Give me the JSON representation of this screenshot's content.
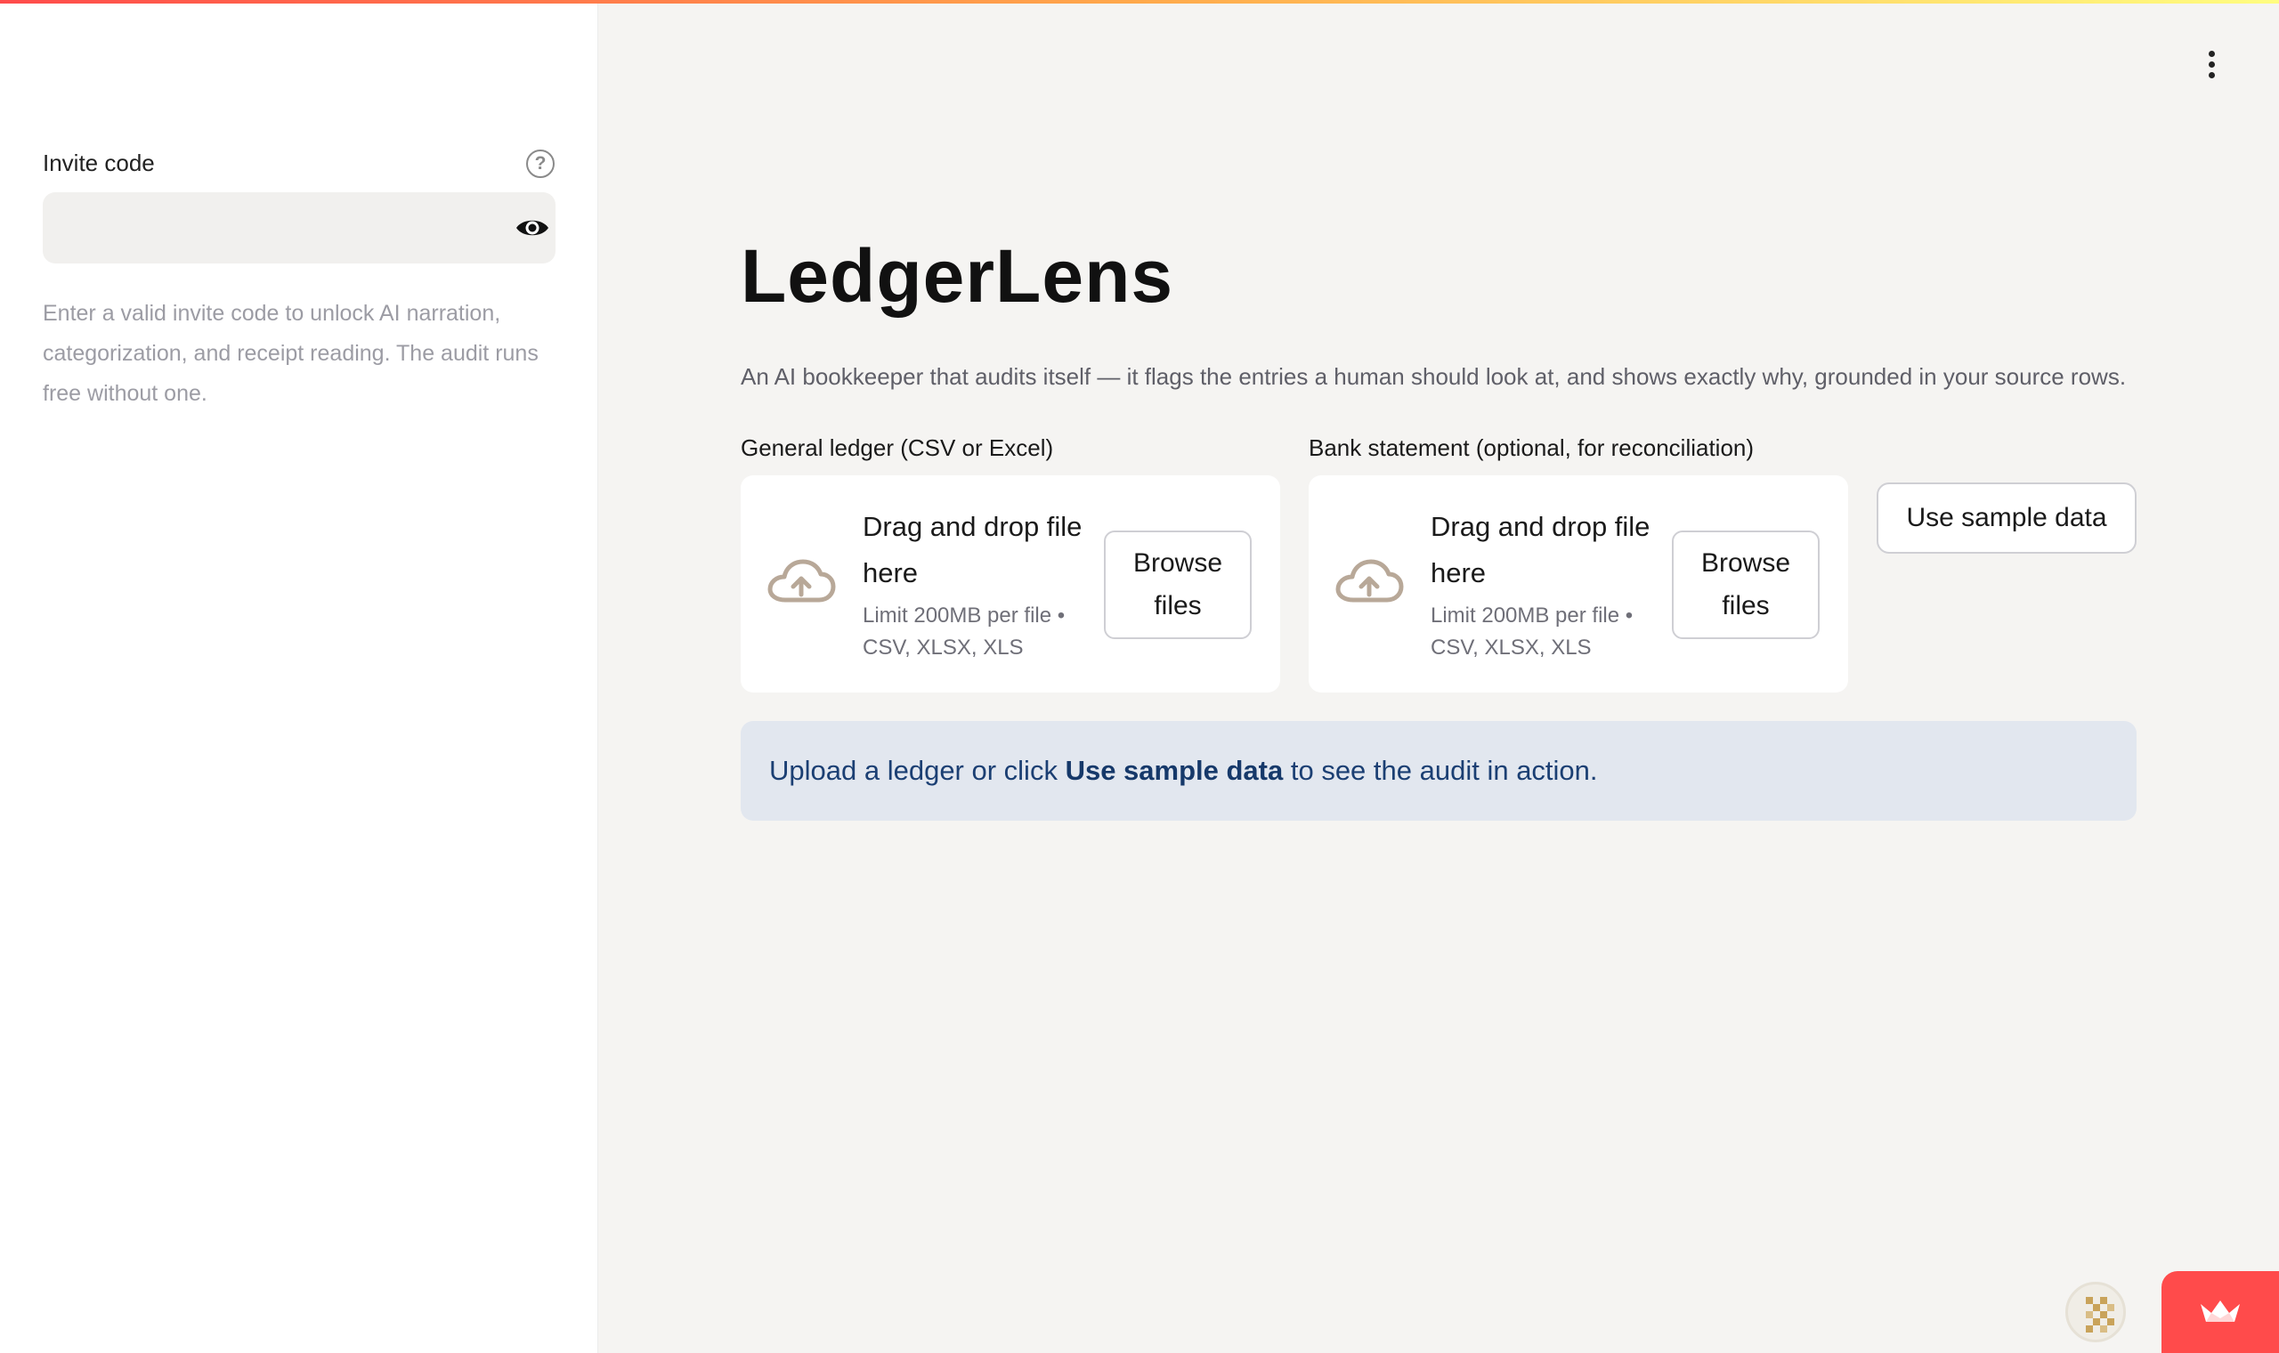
{
  "sidebar": {
    "invite": {
      "label": "Invite code",
      "placeholder": "",
      "value": "",
      "help_text": "Enter a valid invite code to unlock AI narration, categorization, and receipt reading. The audit runs free without one."
    }
  },
  "header": {
    "title": "LedgerLens",
    "subtitle": "An AI bookkeeper that audits itself — it flags the entries a human should look at, and shows exactly why, grounded in your source rows."
  },
  "uploaders": [
    {
      "label": "General ledger (CSV or Excel)",
      "drop_text": "Drag and drop file here",
      "limit_text": "Limit 200MB per file • CSV, XLSX, XLS",
      "browse_label": "Browse files"
    },
    {
      "label": "Bank statement (optional, for reconciliation)",
      "drop_text": "Drag and drop file here",
      "limit_text": "Limit 200MB per file • CSV, XLSX, XLS",
      "browse_label": "Browse files"
    }
  ],
  "actions": {
    "sample_label": "Use sample data"
  },
  "banner": {
    "before": "Upload a ledger or click ",
    "bold": "Use sample data",
    "after": " to see the audit in action."
  },
  "icons": {
    "help": "question-circle-icon",
    "eye": "eye-icon",
    "menu": "vertical-dots-icon",
    "upload": "cloud-upload-icon",
    "deploy": "crown-icon"
  },
  "colors": {
    "accent": "#ff4b4b",
    "banner_bg": "#e2e7ef",
    "banner_text": "#1b3f73",
    "cloud": "#b8a898"
  }
}
